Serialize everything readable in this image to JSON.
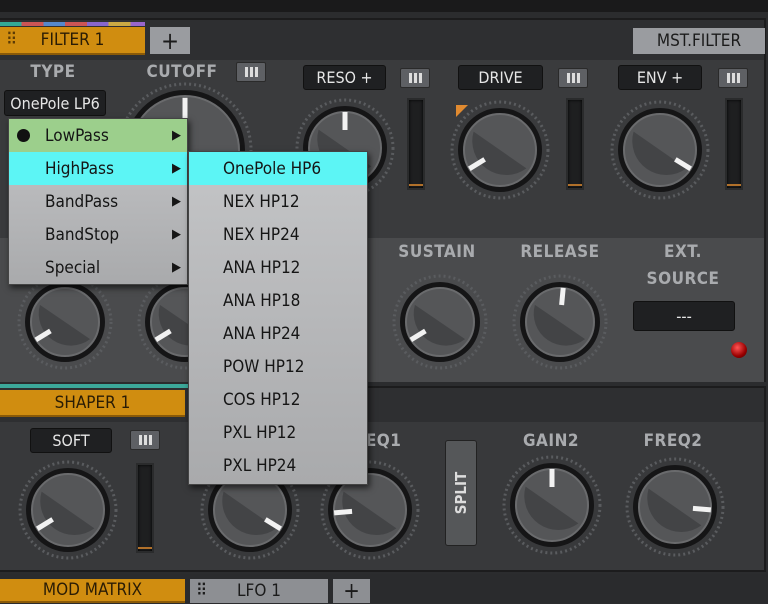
{
  "filter": {
    "tab": "FILTER 1",
    "add": "+",
    "master": "MST.FILTER",
    "type_label": "TYPE",
    "type_value": "OnePole LP6",
    "cutoff_label": "CUTOFF",
    "reso": "RESO +",
    "drive": "DRIVE",
    "env": "ENV +"
  },
  "envelope": {
    "sustain": "SUSTAIN",
    "release": "RELEASE",
    "ext1": "EXT.",
    "ext2": "SOURCE",
    "ext_value": "---"
  },
  "shaper": {
    "tab": "SHAPER 1",
    "mode": "SOFT",
    "freq1": "FREQ1",
    "gain2": "GAIN2",
    "freq2": "FREQ2",
    "split": "SPLIT"
  },
  "bottom": {
    "mod_matrix": "MOD MATRIX",
    "lfo": "LFO 1",
    "add": "+"
  },
  "menu": {
    "items": [
      {
        "label": "LowPass",
        "selected": true
      },
      {
        "label": "HighPass",
        "hovered": true
      },
      {
        "label": "BandPass"
      },
      {
        "label": "BandStop"
      },
      {
        "label": "Special"
      }
    ]
  },
  "submenu": {
    "items": [
      "OnePole HP6",
      "NEX HP12",
      "NEX HP24",
      "ANA HP12",
      "ANA HP18",
      "ANA HP24",
      "POW HP12",
      "COS HP12",
      "PXL HP12",
      "PXL HP24"
    ]
  },
  "knobs": {
    "reso": 0.5,
    "drive": 0.05,
    "env": 0.95,
    "env_attack": 0.05,
    "env_decay": 0.05,
    "sustain": 0.05,
    "release": 0.52,
    "shaper_drive": 0.05,
    "shaper_freq1": 0.95,
    "freq1": 0.15,
    "gain2": 0.5,
    "freq2": 0.85
  },
  "colors": {
    "accent": "#d08d10",
    "hover": "#5cf5f5",
    "selected": "#9ccf8c",
    "led": "#b00000"
  }
}
